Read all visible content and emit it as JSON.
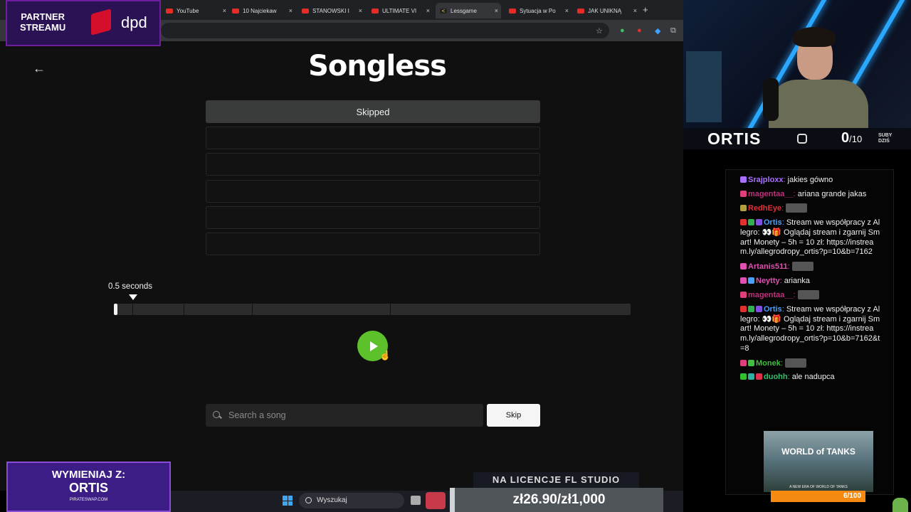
{
  "browser": {
    "tabs": [
      {
        "title": "YouTube",
        "icon": "youtube-icon"
      },
      {
        "title": "10 Najciekaw",
        "icon": "youtube-icon"
      },
      {
        "title": "STANOWSKI I",
        "icon": "youtube-icon"
      },
      {
        "title": "ULTIMATE VI",
        "icon": "youtube-icon"
      },
      {
        "title": "Lessgame",
        "icon": "lessgame-icon"
      },
      {
        "title": "Sytuacja w Po",
        "icon": "youtube-icon"
      },
      {
        "title": "JAK UNIKNĄ",
        "icon": "youtube-icon"
      }
    ],
    "close_symbol": "×",
    "new_tab_symbol": "+",
    "star_symbol": "☆"
  },
  "page": {
    "back_symbol": "←",
    "logo": "Songless",
    "guess_slots": [
      "Skipped",
      "",
      "",
      "",
      "",
      ""
    ],
    "duration_label": "0.5 seconds",
    "progress_fraction": 0.007,
    "search_placeholder": "Search a song",
    "skip_label": "Skip",
    "colors": {
      "accent": "#5cc12a",
      "background": "#101010"
    }
  },
  "overlay": {
    "partner": {
      "line1": "PARTNER",
      "line2": "STREAMU",
      "sponsor": "dpd"
    },
    "streamer": {
      "name": "ORTIS",
      "sub_count": "0",
      "sub_goal": "/10",
      "subs_label_1": "SUBY",
      "subs_label_2": "DZIŚ"
    },
    "chat": [
      {
        "user": "Srajploxx",
        "color": "#a970ff",
        "badges": [
          "#a970ff"
        ],
        "text": "jakies gówno"
      },
      {
        "user": "magentaa__",
        "color": "#c0307a",
        "badges": [
          "#e0407a"
        ],
        "text": "ariana grande jakas"
      },
      {
        "user": "RedhEye",
        "color": "#e0303a",
        "badges": [
          "#b0a040"
        ],
        "text": "",
        "emote": true
      },
      {
        "user": "Ortis",
        "color": "#4aa0ff",
        "badges": [
          "#e03030",
          "#30b050",
          "#8050e0"
        ],
        "text": "Stream we współpracy z Allegro: 👀🎁 Oglądaj stream i zgarnij Smart! Monety – 5h = 10 zł: https://instream.ly/allegrodropy_ortis?p=10&b=7162"
      },
      {
        "user": "Artanis511",
        "color": "#e050b0",
        "badges": [
          "#e050b0"
        ],
        "text": "",
        "emote": true
      },
      {
        "user": "Neytty",
        "color": "#e050b0",
        "badges": [
          "#e050b0",
          "#4aa0ff"
        ],
        "text": "arianka"
      },
      {
        "user": "magentaa__",
        "color": "#c0307a",
        "badges": [
          "#e0407a"
        ],
        "text": "",
        "emote": true
      },
      {
        "user": "Ortis",
        "color": "#4aa0ff",
        "badges": [
          "#e03030",
          "#30b050",
          "#8050e0"
        ],
        "text": "Stream we współpracy z Allegro: 👀🎁 Oglądaj stream i zgarnij Smart! Monety – 5h = 10 zł: https://instream.ly/allegrodropy_ortis?p=10&b=7162&t=8"
      },
      {
        "user": "Monek",
        "color": "#40c040",
        "badges": [
          "#e0407a",
          "#40c040"
        ],
        "text": "",
        "emote": true
      },
      {
        "user": "duohh",
        "color": "#30c070",
        "badges": [
          "#30c030",
          "#30b0a0",
          "#e03050"
        ],
        "text": "ale nadupca"
      }
    ],
    "wot": {
      "title": "WORLD of TANKS",
      "subtitle": "A NEW ERA OF WORLD OF TANKS",
      "progress": "6/100"
    },
    "wymieniaj": {
      "line1": "WYMIENIAJ Z:",
      "line2": "ORTIS",
      "line3": "PIRATESWAP.COM"
    },
    "taskbar_search": "Wyszukaj",
    "fl_studio": "NA LICENCJE FL STUDIO",
    "donation": "zł26.90/zł1,000"
  }
}
